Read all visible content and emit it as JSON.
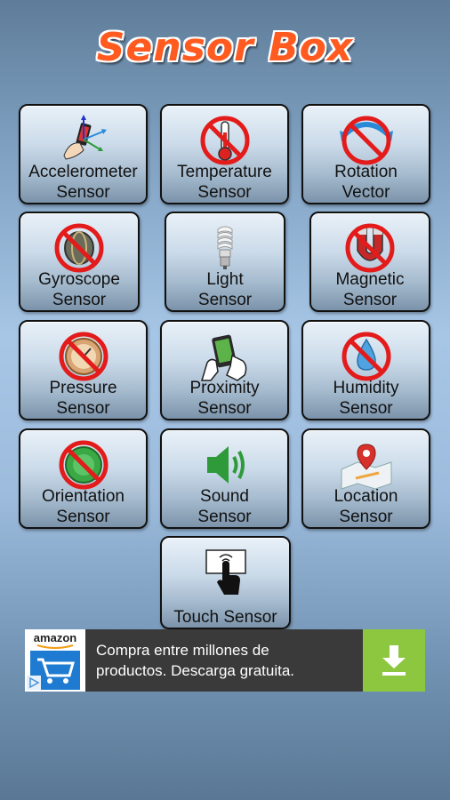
{
  "app": {
    "title": "Sensor Box"
  },
  "tiles": [
    {
      "line1": "Accelerometer",
      "line2": "Sensor",
      "icon": "accelerometer-icon"
    },
    {
      "line1": "Temperature",
      "line2": "Sensor",
      "icon": "temperature-disabled-icon"
    },
    {
      "line1": "Rotation",
      "line2": "Vector",
      "icon": "rotation-disabled-icon"
    },
    {
      "line1": "Gyroscope",
      "line2": "Sensor",
      "icon": "gyroscope-disabled-icon"
    },
    {
      "line1": "Light",
      "line2": "Sensor",
      "icon": "light-bulb-icon"
    },
    {
      "line1": "Magnetic",
      "line2": "Sensor",
      "icon": "magnet-disabled-icon"
    },
    {
      "line1": "Pressure",
      "line2": "Sensor",
      "icon": "pressure-disabled-icon"
    },
    {
      "line1": "Proximity",
      "line2": "Sensor",
      "icon": "proximity-phone-icon"
    },
    {
      "line1": "Humidity",
      "line2": "Sensor",
      "icon": "humidity-disabled-icon"
    },
    {
      "line1": "Orientation",
      "line2": "Sensor",
      "icon": "orientation-disabled-icon"
    },
    {
      "line1": "Sound",
      "line2": "Sensor",
      "icon": "speaker-icon"
    },
    {
      "line1": "Location",
      "line2": "Sensor",
      "icon": "map-pin-icon"
    },
    {
      "line1": "Touch Sensor",
      "line2": "",
      "icon": "touch-hand-icon"
    }
  ],
  "ad": {
    "brand": "amazon",
    "line1": "Compra entre millones de",
    "line2": "productos. Descarga gratuita.",
    "action_icon": "download-arrow-icon",
    "colors": {
      "background": "#3a3a3a",
      "action": "#8dc63f",
      "brand_blue": "#1e7bd1"
    }
  },
  "colors": {
    "title": "#ff5a1f",
    "prohibited": "#e31b1b"
  }
}
